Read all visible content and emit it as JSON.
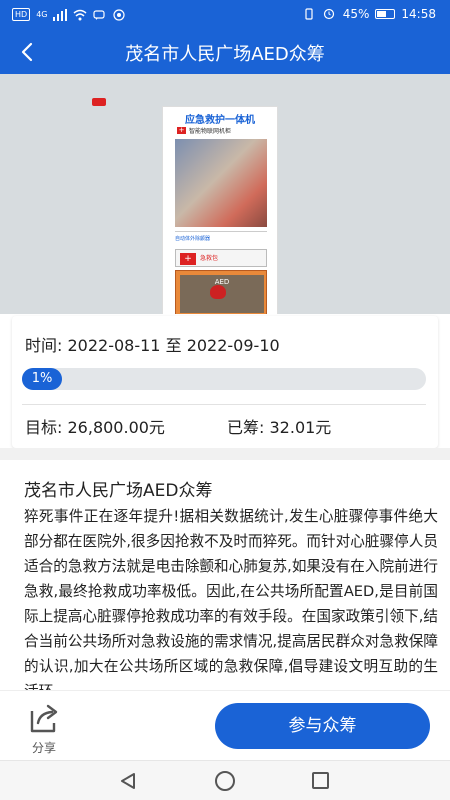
{
  "status_bar": {
    "network_badge": "HD",
    "network_type": "4G",
    "battery_percent": "45%",
    "time": "14:58"
  },
  "header": {
    "title": "茂名市人民广场AED众筹",
    "back_icon": "chevron-left-icon"
  },
  "hero": {
    "kiosk_title": "应急救护一体机",
    "kiosk_subtitle": "智能物联网机柜",
    "kiosk_label": "自动体外除颤器",
    "kiosk_kit_label": "急救包",
    "kiosk_aed_label": "AED"
  },
  "campaign": {
    "time_label": "时间:",
    "start_date": "2022-08-11",
    "date_separator": "至",
    "end_date": "2022-09-10",
    "progress_percent": 1,
    "progress_text": "1%",
    "target_label": "目标:",
    "target_value": "26,800.00元",
    "raised_label": "已筹:",
    "raised_value": "32.01元"
  },
  "description": {
    "title": "茂名市人民广场AED众筹",
    "body": "猝死事件正在逐年提升!据相关数据统计,发生心脏骤停事件绝大部分都在医院外,很多因抢救不及时而猝死。而针对心脏骤停人员适合的急救方法就是电击除颤和心肺复苏,如果没有在入院前进行急救,最终抢救成功率极低。因此,在公共场所配置AED,是目前国际上提高心脏骤停抢救成功率的有效手段。在国家政策引领下,结合当前公共场所对急救设施的需求情况,提高居民群众对急救保障的认识,加大在公共场所区域的急救保障,倡导建设文明互助的生活环"
  },
  "bottom_bar": {
    "share_label": "分享",
    "share_icon": "share-icon",
    "join_label": "参与众筹"
  },
  "colors": {
    "brand_blue": "#1a63d6",
    "progress_track": "#e3e6e9"
  }
}
